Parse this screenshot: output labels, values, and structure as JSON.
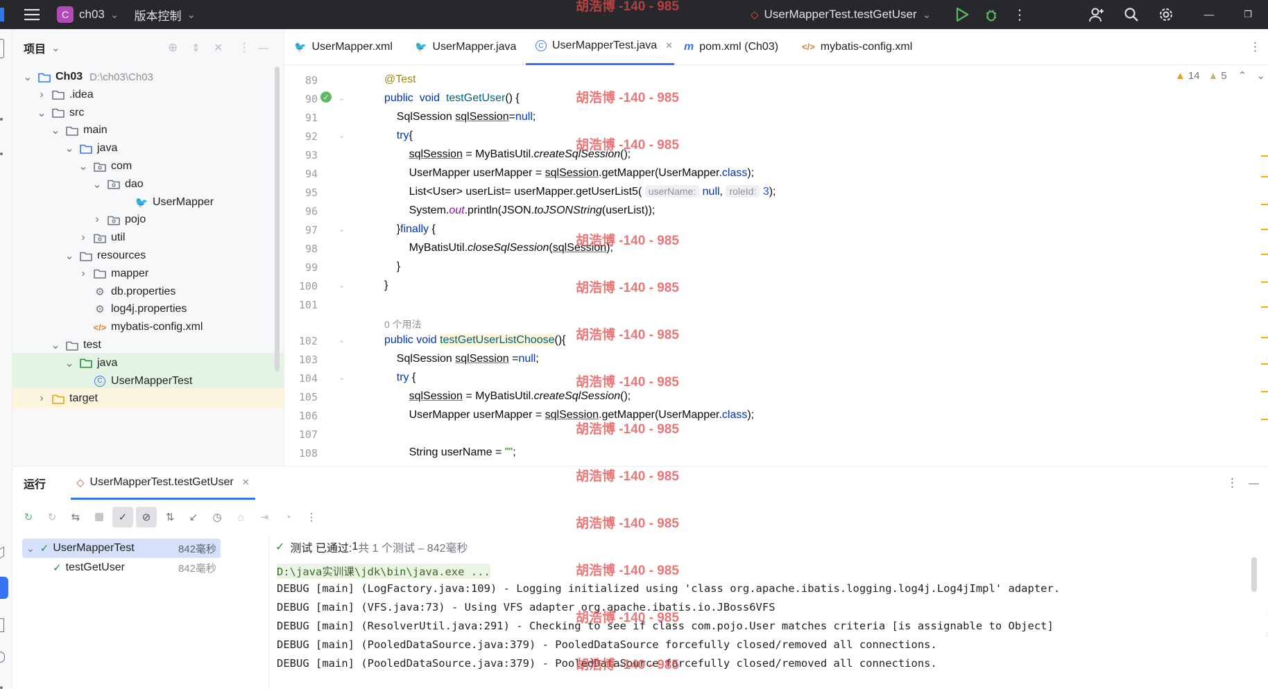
{
  "titlebar": {
    "project_badge": "C",
    "project_name": "ch03",
    "vcs": "版本控制",
    "run_config": "UserMapperTest.testGetUser"
  },
  "project_panel": {
    "title": "项目",
    "tree": [
      {
        "label": "Ch03",
        "path": "D:\\ch03\\Ch03",
        "depth": 0,
        "expanded": true,
        "icon": "module-folder-icon"
      },
      {
        "label": ".idea",
        "depth": 1,
        "expanded": false,
        "icon": "folder-icon"
      },
      {
        "label": "src",
        "depth": 1,
        "expanded": true,
        "icon": "folder-icon"
      },
      {
        "label": "main",
        "depth": 2,
        "expanded": true,
        "icon": "folder-icon"
      },
      {
        "label": "java",
        "depth": 3,
        "expanded": true,
        "icon": "source-folder-icon"
      },
      {
        "label": "com",
        "depth": 4,
        "expanded": true,
        "icon": "package-icon"
      },
      {
        "label": "dao",
        "depth": 5,
        "expanded": true,
        "icon": "package-icon"
      },
      {
        "label": "UserMapper",
        "depth": 7,
        "icon": "mybatis-icon"
      },
      {
        "label": "pojo",
        "depth": 5,
        "expanded": false,
        "icon": "package-icon"
      },
      {
        "label": "util",
        "depth": 4,
        "expanded": false,
        "icon": "package-icon"
      },
      {
        "label": "resources",
        "depth": 3,
        "expanded": true,
        "icon": "resources-folder-icon"
      },
      {
        "label": "mapper",
        "depth": 4,
        "expanded": false,
        "icon": "folder-icon"
      },
      {
        "label": "db.properties",
        "depth": 4,
        "icon": "properties-icon"
      },
      {
        "label": "log4j.properties",
        "depth": 4,
        "icon": "properties-icon"
      },
      {
        "label": "mybatis-config.xml",
        "depth": 4,
        "icon": "xml-icon"
      },
      {
        "label": "test",
        "depth": 2,
        "expanded": true,
        "icon": "folder-icon"
      },
      {
        "label": "java",
        "depth": 3,
        "expanded": true,
        "icon": "test-folder-icon"
      },
      {
        "label": "UserMapperTest",
        "depth": 4,
        "icon": "class-icon"
      },
      {
        "label": "target",
        "depth": 1,
        "expanded": false,
        "icon": "excluded-folder-icon"
      }
    ]
  },
  "editor": {
    "tabs": [
      {
        "label": "UserMapper.xml",
        "icon": "mybatis-icon"
      },
      {
        "label": "UserMapper.java",
        "icon": "mybatis-icon"
      },
      {
        "label": "UserMapperTest.java",
        "icon": "class-icon",
        "active": true
      },
      {
        "label": "pom.xml (Ch03)",
        "icon": "maven-icon"
      },
      {
        "label": "mybatis-config.xml",
        "icon": "xml-icon"
      }
    ],
    "warnings": "14",
    "weak_warnings": "5",
    "usage_hint": "0 个用法",
    "line_numbers": [
      "89",
      "90",
      "91",
      "92",
      "93",
      "94",
      "95",
      "96",
      "97",
      "98",
      "99",
      "100",
      "101",
      "102",
      "103",
      "104",
      "105",
      "106",
      "107",
      "108"
    ],
    "hint_username": "userName:",
    "hint_roleid": "roleId:"
  },
  "run_panel": {
    "title": "运行",
    "tab_label": "UserMapperTest.testGetUser",
    "status_prefix": "测试 已通过: ",
    "status_count": "1",
    "status_suffix": "共 1 个测试 – 842毫秒",
    "tests": [
      {
        "name": "UserMapperTest",
        "time": "842毫秒"
      },
      {
        "name": "testGetUser",
        "time": "842毫秒"
      }
    ],
    "console": [
      "D:\\java实训课\\jdk\\bin\\java.exe ...",
      "DEBUG [main] (LogFactory.java:109) - Logging initialized using 'class org.apache.ibatis.logging.log4j.Log4jImpl' adapter.",
      "DEBUG [main] (VFS.java:73) - Using VFS adapter org.apache.ibatis.io.JBoss6VFS",
      "DEBUG [main] (ResolverUtil.java:291) - Checking to see if class com.pojo.User matches criteria [is assignable to Object]",
      "DEBUG [main] (PooledDataSource.java:379) - PooledDataSource forcefully closed/removed all connections.",
      "DEBUG [main] (PooledDataSource.java:379) - PooledDataSource forcefully closed/removed all connections."
    ]
  },
  "watermark": "胡浩博 -140 - 985",
  "colors": {
    "keyword": "#0033b3",
    "function": "#00627a",
    "annotation": "#9e880d",
    "success": "#208a3c",
    "watermark": "#e24a4a"
  }
}
